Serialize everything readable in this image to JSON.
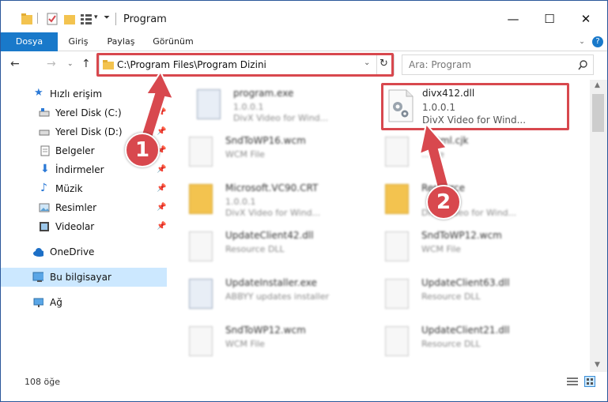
{
  "window": {
    "title": "Program"
  },
  "ribbon": {
    "tabs": [
      "Dosya",
      "Giriş",
      "Paylaş",
      "Görünüm"
    ]
  },
  "address": {
    "path": "C:\\Program Files\\Program Dizini"
  },
  "search": {
    "placeholder": "Ara: Program"
  },
  "sidebar": {
    "items": [
      {
        "label": "Hızlı erişim",
        "icon": "star-icon"
      },
      {
        "label": "Yerel Disk (C:)",
        "icon": "drive-icon",
        "pinned": true
      },
      {
        "label": "Yerel Disk (D:)",
        "icon": "drive-icon",
        "pinned": true
      },
      {
        "label": "Belgeler",
        "icon": "document-icon",
        "pinned": true
      },
      {
        "label": "İndirmeler",
        "icon": "download-icon",
        "pinned": true
      },
      {
        "label": "Müzik",
        "icon": "music-icon",
        "pinned": true
      },
      {
        "label": "Resimler",
        "icon": "pictures-icon",
        "pinned": true
      },
      {
        "label": "Videolar",
        "icon": "video-icon",
        "pinned": true
      },
      {
        "label": "OneDrive",
        "icon": "cloud-icon"
      },
      {
        "label": "Bu bilgisayar",
        "icon": "computer-icon",
        "selected": true
      },
      {
        "label": "Ağ",
        "icon": "network-icon"
      }
    ]
  },
  "files": [
    {
      "name": "program.exe",
      "line1": "1.0.0.1",
      "line2": "DivX Video for Wind...",
      "kind": "exe"
    },
    {
      "name": "divx412.dll",
      "line1": "1.0.0.1",
      "line2": "DivX Video for Wind...",
      "kind": "dll"
    },
    {
      "name": "SndToWP16.wcm",
      "line1": "WCM File",
      "line2": "",
      "kind": "file"
    },
    {
      "name": "...html.cjk",
      "line1": "...File",
      "line2": "",
      "kind": "file"
    },
    {
      "name": "Microsoft.VC90.CRT",
      "line1": "1.0.0.1",
      "line2": "DivX Video for Wind...",
      "kind": "folder"
    },
    {
      "name": "Resource",
      "line1": "",
      "line2": "DivX Video for Wind...",
      "kind": "folder"
    },
    {
      "name": "UpdateClient42.dll",
      "line1": "Resource DLL",
      "line2": "",
      "kind": "file"
    },
    {
      "name": "SndToWP12.wcm",
      "line1": "WCM File",
      "line2": "",
      "kind": "file"
    },
    {
      "name": "UpdateInstaller.exe",
      "line1": "ABBYY updates installer",
      "line2": "",
      "kind": "exe"
    },
    {
      "name": "UpdateClient63.dll",
      "line1": "Resource DLL",
      "line2": "",
      "kind": "file"
    },
    {
      "name": "SndToWP12.wcm",
      "line1": "WCM File",
      "line2": "",
      "kind": "file"
    },
    {
      "name": "UpdateClient21.dll",
      "line1": "Resource DLL",
      "line2": "",
      "kind": "file"
    }
  ],
  "status": {
    "count": "108 öğe"
  },
  "callouts": {
    "one": "1",
    "two": "2"
  },
  "colors": {
    "accent": "#1979ca",
    "highlight": "#d8484e",
    "selected": "#cce8ff"
  }
}
